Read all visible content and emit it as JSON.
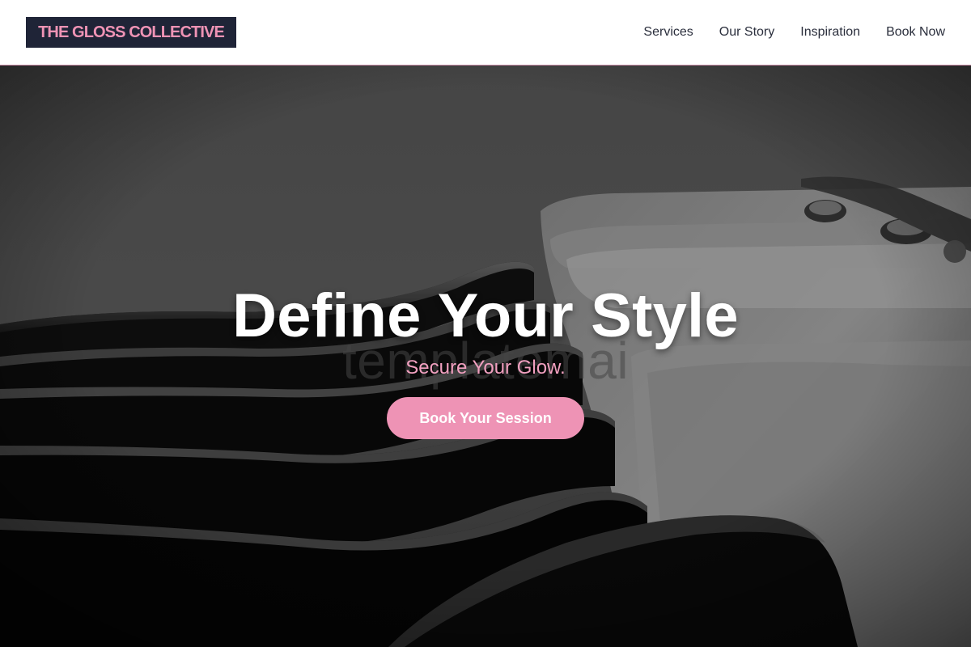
{
  "header": {
    "logo": "THE GLOSS COLLECTIVE",
    "nav": [
      "Services",
      "Our Story",
      "Inspiration",
      "Book Now"
    ]
  },
  "hero": {
    "title": "Define Your Style",
    "watermark": "templatemai",
    "subtitle": "Secure Your Glow.",
    "cta_label": "Book Your Session",
    "background_description_icon": "salon-wash-chairs-photo"
  },
  "colors": {
    "accent": "#ee93b5",
    "logo_bg": "#1f2437",
    "header_bg": "#ffffff",
    "nav_text": "#2a2e3c"
  }
}
